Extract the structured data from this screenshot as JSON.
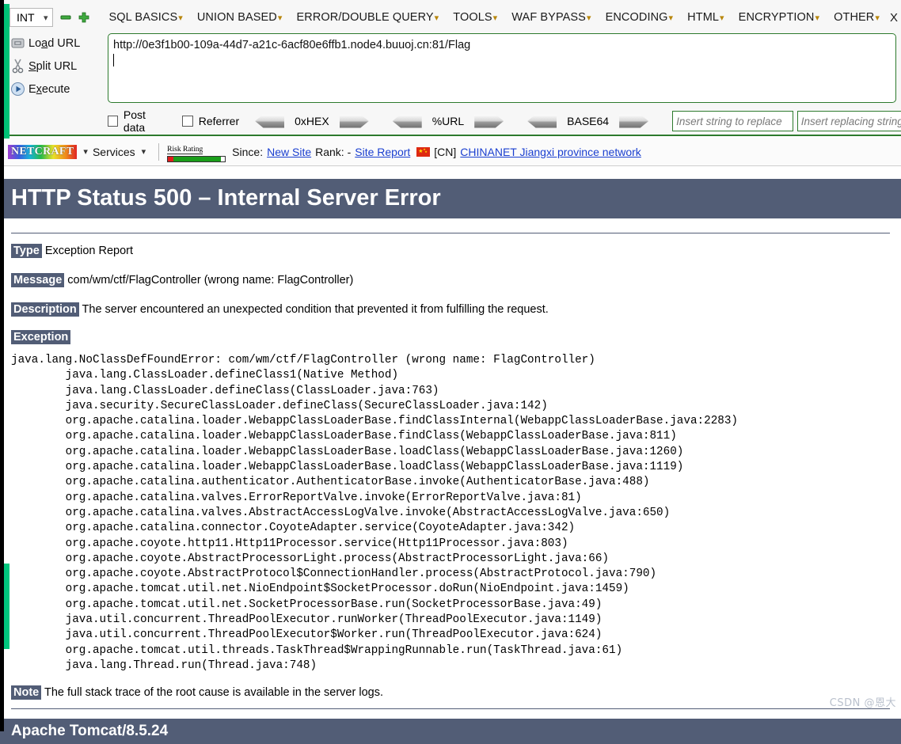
{
  "hackbar": {
    "type_select": {
      "value": "INT",
      "chevron": "chevron-down-icon"
    },
    "minus_button": "–",
    "plus_button": "+",
    "menus": [
      {
        "label": "SQL BASICS",
        "caret": "▾"
      },
      {
        "label": "UNION BASED",
        "caret": "▾"
      },
      {
        "label": "ERROR/DOUBLE QUERY",
        "caret": "▾"
      },
      {
        "label": "TOOLS",
        "caret": "▾"
      },
      {
        "label": "WAF BYPASS",
        "caret": "▾"
      },
      {
        "label": "ENCODING",
        "caret": "▾"
      },
      {
        "label": "HTML",
        "caret": "▾"
      },
      {
        "label": "ENCRYPTION",
        "caret": "▾"
      },
      {
        "label": "OTHER",
        "caret": "▾"
      }
    ],
    "menu_overflow": "X",
    "actions": [
      {
        "label": "Load URL",
        "icon": "load-url-icon"
      },
      {
        "label": "Split URL",
        "icon": "scissors-icon"
      },
      {
        "label": "Execute",
        "icon": "play-icon"
      }
    ],
    "url_value": "http://0e3f1b00-109a-44d7-a21c-6acf80e6ffb1.node4.buuoj.cn:81/Flag",
    "checkboxes": [
      {
        "label": "Post data",
        "checked": false
      },
      {
        "label": "Referrer",
        "checked": false
      }
    ],
    "encoders": [
      {
        "label": "0xHEX"
      },
      {
        "label": "%URL"
      },
      {
        "label": "BASE64"
      }
    ],
    "replace_input_placeholder": "Insert string to replace",
    "replacing_input_placeholder": "Insert replacing string"
  },
  "netcraft": {
    "logo_text": "NETCRAFT",
    "logo_caret": "▾",
    "services_label": "Services",
    "services_caret": "▾",
    "risk_rating_label": "Risk Rating",
    "since_label": "Since:",
    "since_link": "New Site",
    "rank_label": "Rank: -",
    "site_report_link": "Site Report",
    "country_code": "[CN]",
    "network_link": "CHINANET Jiangxi province network",
    "flag_icon": "china-flag-icon"
  },
  "tomcat": {
    "title": "HTTP Status 500 – Internal Server Error",
    "type_label": "Type",
    "type_value": "Exception Report",
    "message_label": "Message",
    "message_value": "com/wm/ctf/FlagController (wrong name: FlagController)",
    "description_label": "Description",
    "description_value": "The server encountered an unexpected condition that prevented it from fulfilling the request.",
    "exception_label": "Exception",
    "stack_trace": "java.lang.NoClassDefFoundError: com/wm/ctf/FlagController (wrong name: FlagController)\n        java.lang.ClassLoader.defineClass1(Native Method)\n        java.lang.ClassLoader.defineClass(ClassLoader.java:763)\n        java.security.SecureClassLoader.defineClass(SecureClassLoader.java:142)\n        org.apache.catalina.loader.WebappClassLoaderBase.findClassInternal(WebappClassLoaderBase.java:2283)\n        org.apache.catalina.loader.WebappClassLoaderBase.findClass(WebappClassLoaderBase.java:811)\n        org.apache.catalina.loader.WebappClassLoaderBase.loadClass(WebappClassLoaderBase.java:1260)\n        org.apache.catalina.loader.WebappClassLoaderBase.loadClass(WebappClassLoaderBase.java:1119)\n        org.apache.catalina.authenticator.AuthenticatorBase.invoke(AuthenticatorBase.java:488)\n        org.apache.catalina.valves.ErrorReportValve.invoke(ErrorReportValve.java:81)\n        org.apache.catalina.valves.AbstractAccessLogValve.invoke(AbstractAccessLogValve.java:650)\n        org.apache.catalina.connector.CoyoteAdapter.service(CoyoteAdapter.java:342)\n        org.apache.coyote.http11.Http11Processor.service(Http11Processor.java:803)\n        org.apache.coyote.AbstractProcessorLight.process(AbstractProcessorLight.java:66)\n        org.apache.coyote.AbstractProtocol$ConnectionHandler.process(AbstractProtocol.java:790)\n        org.apache.tomcat.util.net.NioEndpoint$SocketProcessor.doRun(NioEndpoint.java:1459)\n        org.apache.tomcat.util.net.SocketProcessorBase.run(SocketProcessorBase.java:49)\n        java.util.concurrent.ThreadPoolExecutor.runWorker(ThreadPoolExecutor.java:1149)\n        java.util.concurrent.ThreadPoolExecutor$Worker.run(ThreadPoolExecutor.java:624)\n        org.apache.tomcat.util.threads.TaskThread$WrappingRunnable.run(TaskThread.java:61)\n        java.lang.Thread.run(Thread.java:748)",
    "note_label": "Note",
    "note_value": "The full stack trace of the root cause is available in the server logs.",
    "footer": "Apache Tomcat/8.5.24"
  },
  "watermark": "CSDN @恩大",
  "colors": {
    "tomcat_header": "#525D76",
    "link": "#1a3fd0",
    "hackbar_border": "#2d7a2d",
    "edge_green": "#00c176"
  }
}
